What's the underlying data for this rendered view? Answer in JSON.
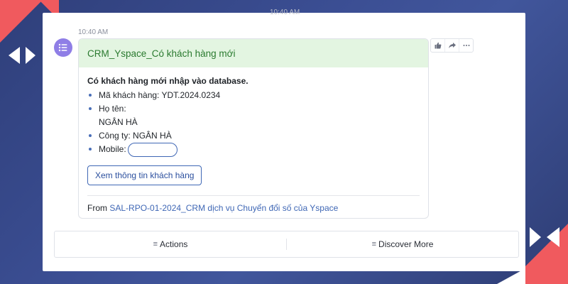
{
  "top_timestamp": "10:40 AM",
  "message": {
    "timestamp": "10:40 AM",
    "avatar_icon": "list-icon",
    "card": {
      "title": "CRM_Yspace_Có khách hàng mới",
      "intro": "Có khách hàng mới nhập vào database.",
      "fields": {
        "customer_code": "Mã khách hàng: YDT.2024.0234",
        "name_label": "Họ tên:",
        "name_value": "NGÂN HÀ",
        "company": "Công ty:  NGÂN HÀ",
        "mobile_label": "Mobile:"
      },
      "view_button": "Xem thông tin khách hàng",
      "from_prefix": "From",
      "from_link": "SAL-RPO-01-2024_CRM dịch vụ Chuyển đổi số của Yspace"
    },
    "reactions": [
      "thumbs-up-icon",
      "share-icon",
      "more-icon"
    ]
  },
  "actions": {
    "actions_label": "Actions",
    "discover_label": "Discover More",
    "menu_glyph": "≡"
  },
  "colors": {
    "accent": "#3f67b5",
    "header_bg": "#e3f5e1",
    "title_green": "#2a7a2f",
    "avatar": "#8f7ee6",
    "decor_red": "#f05a5e"
  }
}
